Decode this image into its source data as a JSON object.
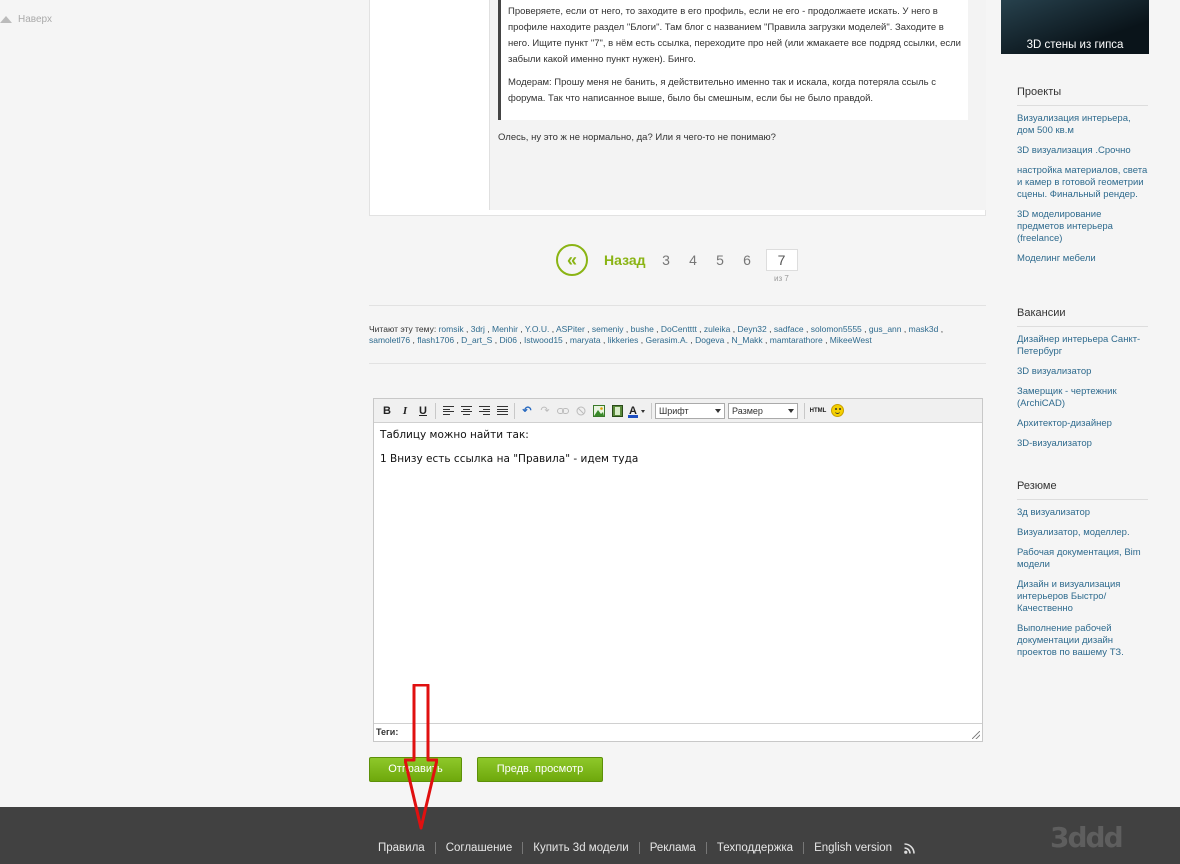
{
  "back_to_top": "Наверх",
  "post": {
    "quote_paragraphs": [
      "Проверяете,  если от него,  то заходите в его профиль, если не его - продолжаете искать. У него в профиле находите раздел \"Блоги\". Там блог с названием \"Правила загрузки моделей\". Заходите в него. Ищите пункт \"7\", в нём есть ссылка,  переходите про ней (или жмакаете все подряд ссылки, если забыли какой именно пункт нужен). Бинго.",
      "Модерам: Прошу меня не банить,  я действительно именно так и искала, когда потеряла ссыль с форума. Так что написанное выше, было бы смешным,  если бы не было правдой."
    ],
    "reply": "Олесь, ну это ж не нормально, да? Или я чего-то не понимаю?"
  },
  "pagination": {
    "back_icon": "«",
    "back_label": "Назад",
    "pages": [
      "3",
      "4",
      "5",
      "6"
    ],
    "current": "7",
    "of_label": "из 7"
  },
  "readers": {
    "label": "Читают эту тему:",
    "users": [
      "romsik",
      "3drj",
      "Menhir",
      "Y.O.U.",
      "ASPiter",
      "semeniy",
      "bushe",
      "DoCentttt",
      "zuleika",
      "Deyn32",
      "sadface",
      "solomon5555",
      "gus_ann",
      "mask3d",
      "samoletl76",
      "flash1706",
      "D_art_S",
      "Di06",
      "Istwood15",
      "maryata",
      "likkeries",
      "Gerasim.A.",
      "Dogeva",
      "N_Makk",
      "mamtarathore",
      "MikeeWest"
    ]
  },
  "editor": {
    "toolbar": {
      "bold": "B",
      "italic": "I",
      "underline": "U",
      "undo_icon": "↶",
      "redo_icon": "↷",
      "font_select": "Шрифт",
      "size_select": "Размер",
      "html_label": "HTML"
    },
    "lines": [
      "Таблицу можно найти так:",
      "1 Внизу есть ссылка на \"Правила\" - идем туда"
    ],
    "tags_label": "Теги:"
  },
  "buttons": {
    "send": "Отправить",
    "preview": "Предв. просмотр"
  },
  "sidebar": {
    "banner_text": "3D стены из гипса",
    "sections": [
      {
        "title": "Проекты",
        "items": [
          "Визуализация интерьера, дом 500 кв.м",
          "3D визуализация .Срочно",
          "настройка материалов, света и камер в готовой геометрии сцены. Финальный рендер.",
          "3D моделирование предметов интерьера (freelance)",
          "Моделинг мебели"
        ]
      },
      {
        "title": "Вакансии",
        "items": [
          "Дизайнер интерьера Санкт-Петербург",
          "3D визуализатор",
          "Замерщик - чертежник (ArchiCAD)",
          "Архитектор-дизайнер",
          "3D-визуализатор"
        ]
      },
      {
        "title": "Резюме",
        "items": [
          "3д визуализатор",
          "Визуализатор, моделлер.",
          "Рабочая документация, Bim модели",
          "Дизайн и визуализация интерьеров Быстро/Качественно",
          "Выполнение рабочей документации дизайн проектов по вашему ТЗ."
        ]
      }
    ]
  },
  "footer": {
    "links": [
      "Правила",
      "Соглашение",
      "Купить 3d модели",
      "Реклама",
      "Техподдержка",
      "English version"
    ],
    "logo": "3ddd"
  },
  "colors": {
    "accent_green": "#8ab414",
    "link_blue": "#2f6b8e",
    "footer_bg": "#414141",
    "annotation_red": "#e01010"
  }
}
